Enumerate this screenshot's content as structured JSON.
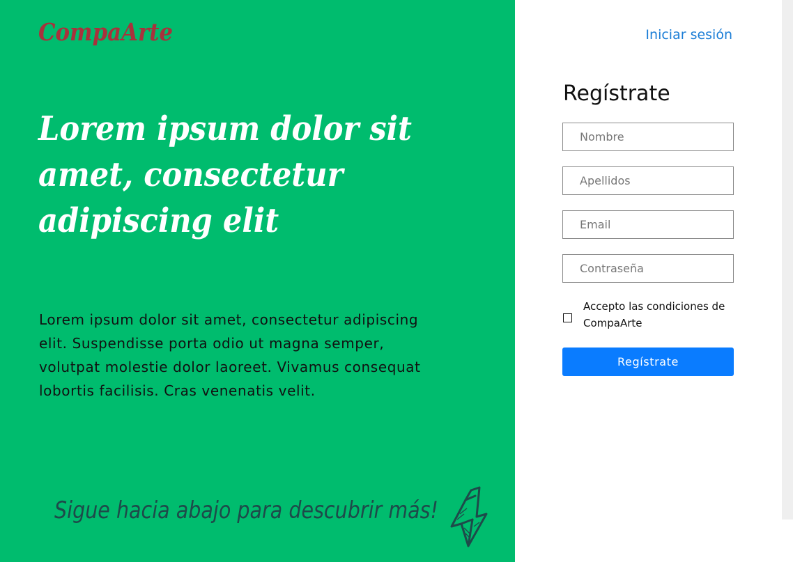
{
  "hero": {
    "brand": "CompaArte",
    "headline_lines": [
      "Lorem ipsum dolor sit",
      "amet, consectetur",
      "adipiscing elit"
    ],
    "body": "Lorem ipsum dolor sit amet, consectetur adipiscing elit. Suspendisse porta odio ut magna semper, volutpat molestie dolor laoreet. Vivamus consequat lobortis facilisis. Cras venenatis velit.",
    "scroll_hint": "Sigue hacia abajo para descubrir más!",
    "scroll_icon": "arrow-down-icon"
  },
  "nav": {
    "login_link": "Iniciar sesión"
  },
  "form": {
    "title": "Regístrate",
    "fields": {
      "nombre": {
        "placeholder": "Nombre",
        "value": ""
      },
      "apellidos": {
        "placeholder": "Apellidos",
        "value": ""
      },
      "email": {
        "placeholder": "Email",
        "value": ""
      },
      "password": {
        "placeholder": "Contraseña",
        "value": ""
      }
    },
    "terms": {
      "checked": false,
      "label": "Accepto las condiciones de CompaArte"
    },
    "submit_label": "Regístrate"
  },
  "colors": {
    "hero_background": "#00bc6e",
    "brand": "#a8323c",
    "link": "#1a7dd6",
    "primary_button": "#0a7cff",
    "scroll_hint": "#1e4a4a"
  }
}
